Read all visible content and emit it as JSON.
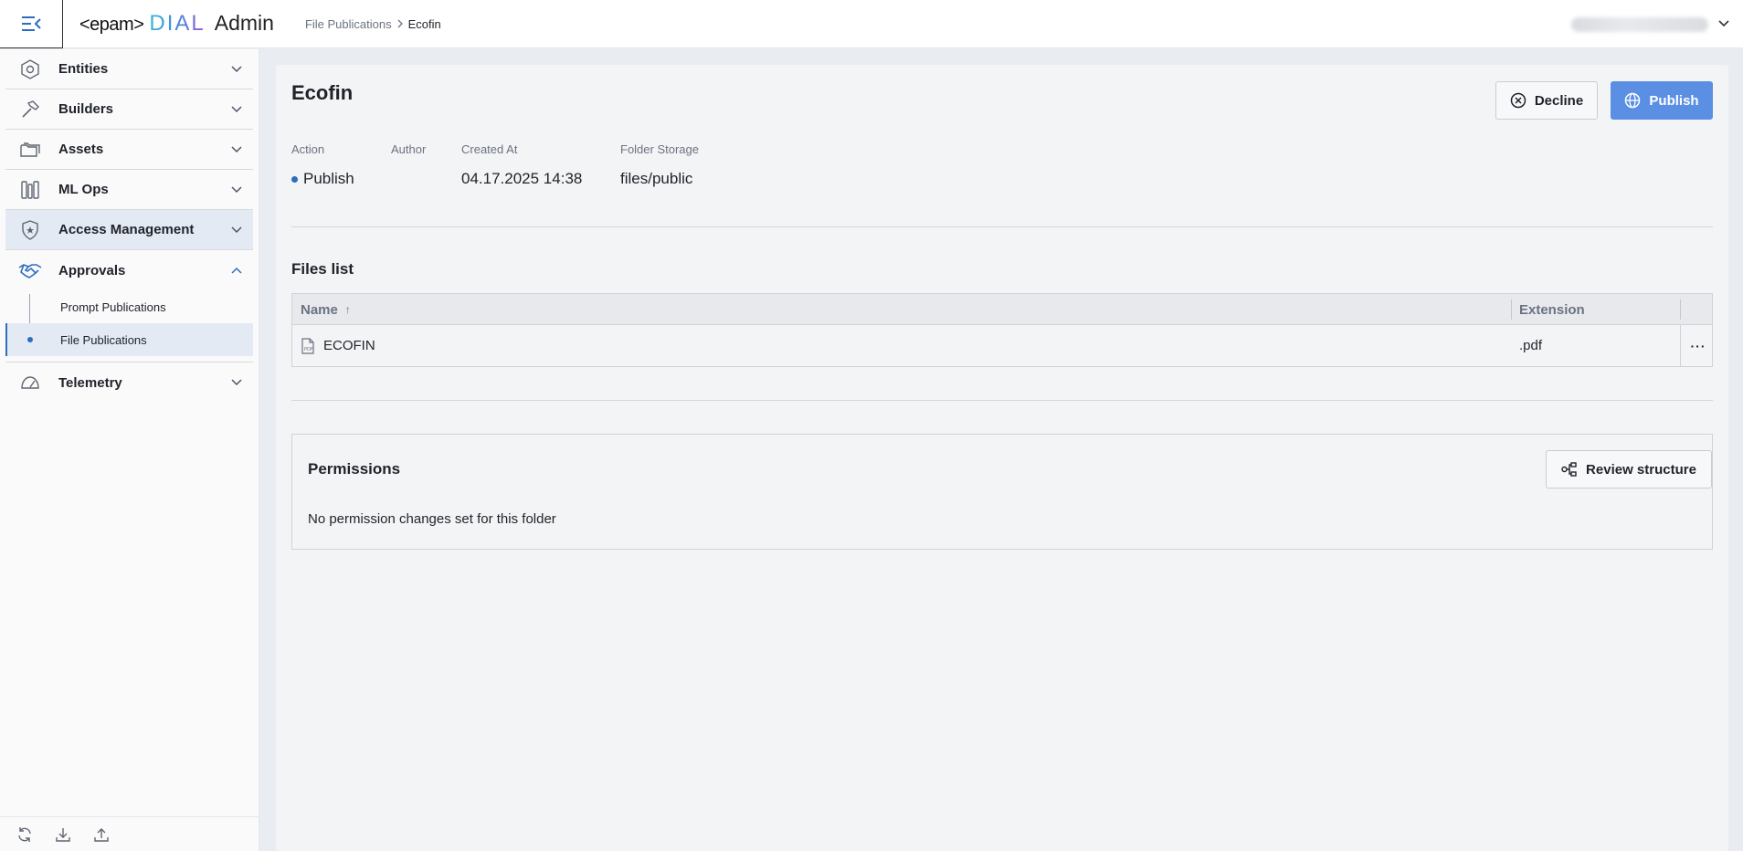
{
  "header": {
    "logo_epam": "<epam>",
    "logo_dial": "DIAL",
    "logo_admin": "Admin",
    "breadcrumb_parent": "File Publications",
    "breadcrumb_current": "Ecofin"
  },
  "sidebar": {
    "items": [
      {
        "label": "Entities",
        "icon": "hexagon-icon"
      },
      {
        "label": "Builders",
        "icon": "hammer-icon"
      },
      {
        "label": "Assets",
        "icon": "folders-icon"
      },
      {
        "label": "ML Ops",
        "icon": "mlops-icon"
      },
      {
        "label": "Access Management",
        "icon": "shield-star-icon"
      },
      {
        "label": "Approvals",
        "icon": "handshake-icon"
      },
      {
        "label": "Telemetry",
        "icon": "gauge-icon"
      }
    ],
    "approvals_sub": [
      "Prompt Publications",
      "File Publications"
    ]
  },
  "main": {
    "title": "Ecofin",
    "decline_label": "Decline",
    "publish_label": "Publish",
    "meta": {
      "action_label": "Action",
      "action_value": "Publish",
      "author_label": "Author",
      "author_value": "",
      "created_label": "Created At",
      "created_value": "04.17.2025 14:38",
      "storage_label": "Folder Storage",
      "storage_value": "files/public"
    },
    "files_title": "Files list",
    "table": {
      "columns": [
        "Name",
        "Extension"
      ],
      "sort_indicator": "↑",
      "rows": [
        {
          "name": "ECOFIN",
          "extension": ".pdf"
        }
      ],
      "more_label": "···"
    },
    "permissions": {
      "title": "Permissions",
      "review_label": "Review structure",
      "empty_text": "No permission changes set for this folder"
    }
  },
  "colors": {
    "accent": "#2c6dbd",
    "publish_button": "#5b8fe3",
    "highlight": "#e4eaf4"
  }
}
